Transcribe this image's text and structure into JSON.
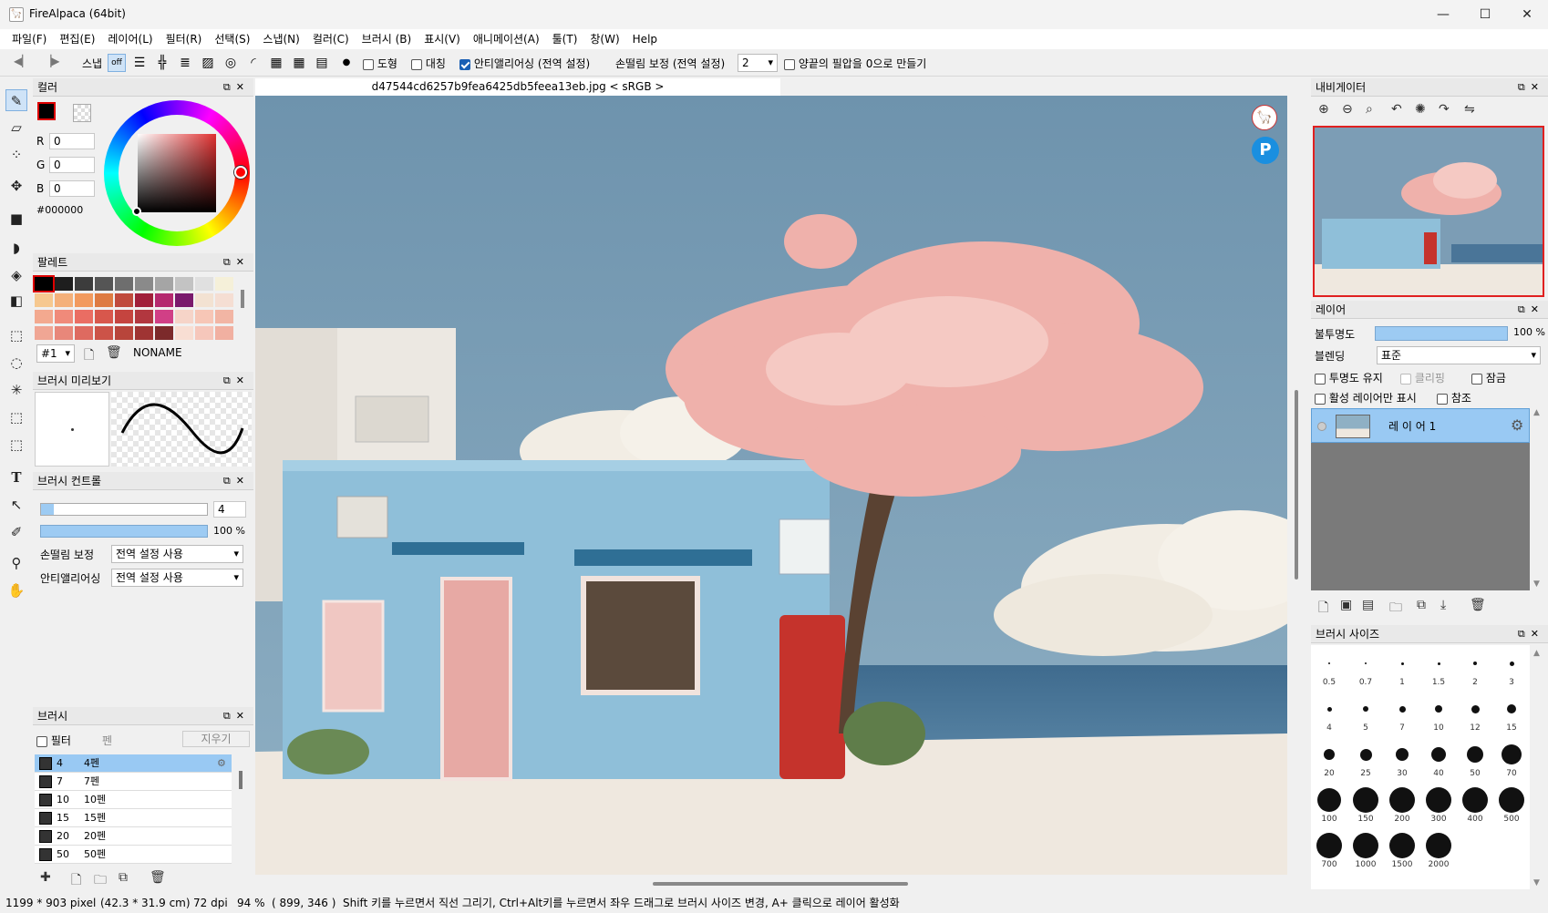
{
  "window": {
    "title": "FireAlpaca (64bit)",
    "minimize": "—",
    "maximize": "☐",
    "close": "✕"
  },
  "menu": [
    "파일(F)",
    "편집(E)",
    "레이어(L)",
    "필터(R)",
    "선택(S)",
    "스냅(N)",
    "컬러(C)",
    "브러시 (B)",
    "표시(V)",
    "애니메이션(A)",
    "툴(T)",
    "창(W)",
    "Help"
  ],
  "toolbar": {
    "snap_label": "스냅",
    "snap_off": "off",
    "shape_label": "도형",
    "symmetry_label": "대칭",
    "antialias_label": "안티앨리어싱 (전역 설정)",
    "stabilizer_label": "손떨림 보정 (전역 설정)",
    "stabilizer_value": "2",
    "pressure_label": "양끝의 필압을 0으로 만들기"
  },
  "color_panel": {
    "title": "컬러",
    "r_label": "R",
    "r_value": "0",
    "g_label": "G",
    "g_value": "0",
    "b_label": "B",
    "b_value": "0",
    "hex": "#000000",
    "fg_color": "#000000",
    "bg_color": "#ffffff"
  },
  "palette_panel": {
    "title": "팔레트",
    "selector": "#1",
    "name": "NONAME",
    "swatches": [
      [
        "#000000",
        "#1e1e1e",
        "#3c3c3c",
        "#555555",
        "#6e6e6e",
        "#8a8a8a",
        "#a5a5a5",
        "#c3c3c3",
        "#e0e0e0",
        "#f5f0d9"
      ],
      [
        "#f6c88f",
        "#f4b07a",
        "#f29a5e",
        "#de7b42",
        "#c04a3c",
        "#a11f3a",
        "#b5296e",
        "#7a1a6c",
        "#f3e2d2",
        "#f5ded3"
      ],
      [
        "#f3a98f",
        "#f08a7a",
        "#ea6d63",
        "#d8574c",
        "#c5443f",
        "#b2373f",
        "#d13f86",
        "#f6d4c8",
        "#f7c6b6",
        "#f2b5a4"
      ],
      [
        "#f0a694",
        "#e8877a",
        "#de6a60",
        "#cc5348",
        "#b8453b",
        "#9f3433",
        "#7c2a2b",
        "#f8ded3",
        "#f6c7bb",
        "#f1b0a1"
      ]
    ]
  },
  "brush_preview": {
    "title": "브러시 미리보기"
  },
  "brush_control": {
    "title": "브러시 컨트롤",
    "size_value": "4",
    "opacity_value": "100 %",
    "stabilizer_label": "손떨림 보정",
    "stabilizer_value": "전역 설정 사용",
    "antialias_label": "안티앨리어싱",
    "antialias_value": "전역 설정 사용"
  },
  "brush_panel": {
    "title": "브러시",
    "filter_label": "필터",
    "category": "펜",
    "erase_label": "지우기",
    "items": [
      {
        "size": "4",
        "name": "4펜"
      },
      {
        "size": "7",
        "name": "7펜"
      },
      {
        "size": "10",
        "name": "10펜"
      },
      {
        "size": "15",
        "name": "15펜"
      },
      {
        "size": "20",
        "name": "20펜"
      },
      {
        "size": "50",
        "name": "50펜"
      }
    ]
  },
  "document": {
    "tab_title": "d47544cd6257b9fea6425db5feea13eb.jpg < sRGB >"
  },
  "navigator": {
    "title": "내비게이터"
  },
  "layer_panel": {
    "title": "레이어",
    "opacity_label": "불투명도",
    "opacity_value": "100 %",
    "opacity_fraction": 1.0,
    "blend_label": "블렌딩",
    "blend_value": "표준",
    "keep_opacity": "투명도 유지",
    "clipping": "클리핑",
    "lock": "잠금",
    "active_only": "활성 레이어만 표시",
    "reference": "참조",
    "layers": [
      {
        "name": "레 이 어 1"
      }
    ]
  },
  "brush_size_panel": {
    "title": "브러시 사이즈",
    "sizes": [
      "0.5",
      "0.7",
      "1",
      "1.5",
      "2",
      "3",
      "4",
      "5",
      "7",
      "10",
      "12",
      "15",
      "20",
      "25",
      "30",
      "40",
      "50",
      "70",
      "100",
      "150",
      "200",
      "300",
      "400",
      "500",
      "700",
      "1000",
      "1500",
      "2000"
    ]
  },
  "status": {
    "dimensions": "1199 * 903 pixel",
    "physical": "(42.3 * 31.9 cm)",
    "dpi": "72 dpi",
    "zoom": "94 %",
    "cursor": "( 899, 346 )",
    "hint": "Shift 키를 누르면서 직선 그리기, Ctrl+Alt키를 누르면서 좌우 드래그로 브러시 사이즈 변경, A+ 클릭으로 레이어 활성화"
  }
}
